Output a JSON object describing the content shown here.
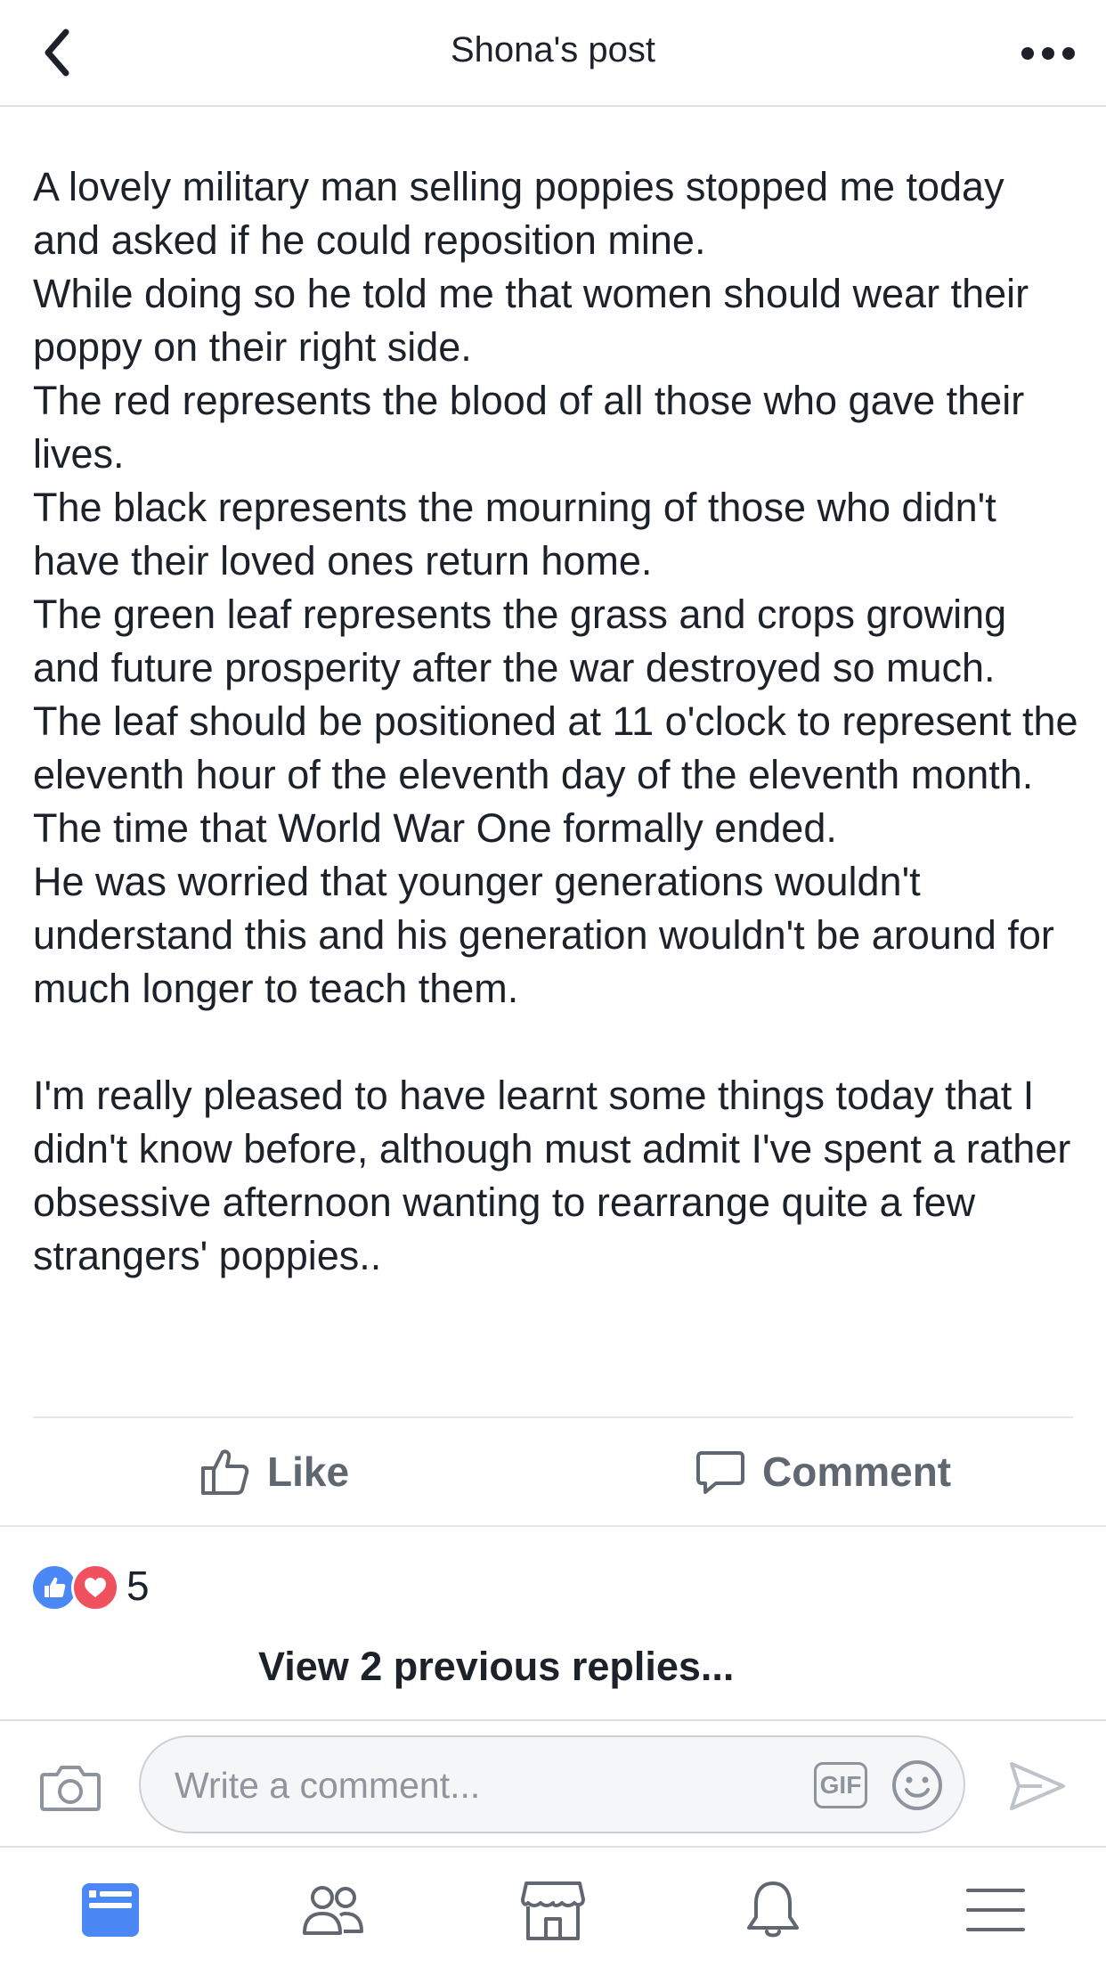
{
  "header": {
    "title": "Shona's post",
    "back_icon": "chevron-left-icon",
    "more_icon": "more-dots-icon"
  },
  "post": {
    "paragraphs": [
      "A lovely military man selling poppies stopped me today and asked if he could reposition mine.",
      "While doing so he told me that women should wear their poppy on their right side.",
      "The red represents the blood of all those who gave their lives.",
      "The black represents the mourning of those who didn't have their loved ones return home.",
      "The green leaf represents the grass and crops growing and future prosperity after the war destroyed so much.",
      "The leaf should be positioned at 11 o'clock to represent the eleventh hour of the eleventh day of the eleventh month.",
      "The time that World War One formally ended.",
      "He was worried that younger generations wouldn't understand this and his generation wouldn't be around for much longer to teach them.",
      "I'm really pleased to have learnt some things today that I didn't know before, although must admit I've spent a rather obsessive afternoon wanting to rearrange quite a few strangers' poppies.."
    ]
  },
  "actions": {
    "like_label": "Like",
    "comment_label": "Comment",
    "like_icon": "thumbs-up-icon",
    "comment_icon": "speech-bubble-icon"
  },
  "reactions": {
    "count": "5",
    "icons": [
      "like-reaction-icon",
      "love-reaction-icon"
    ],
    "like_color": "#4b87f5",
    "love_color": "#f0515f"
  },
  "replies": {
    "view_previous_label": "View 2 previous replies..."
  },
  "composer": {
    "placeholder": "Write a comment...",
    "gif_label": "GIF",
    "camera_icon": "camera-icon",
    "emoji_icon": "smiley-icon",
    "send_icon": "send-icon"
  },
  "tabbar": {
    "tabs": [
      "news-feed-icon",
      "friends-icon",
      "marketplace-icon",
      "notifications-icon",
      "menu-icon"
    ],
    "active_color": "#4b87f5",
    "inactive_color": "#606770"
  }
}
